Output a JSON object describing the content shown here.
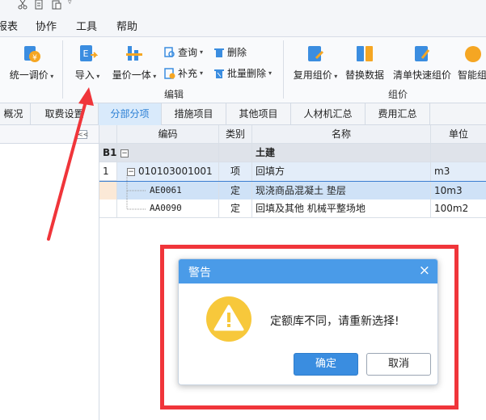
{
  "menu": {
    "items": [
      "报表",
      "协作",
      "工具",
      "帮助"
    ]
  },
  "ribbon": {
    "unified_price": "统一调价",
    "import": "导入",
    "price_integration": "量价一体",
    "query": "查询",
    "supplement": "补充",
    "delete": "删除",
    "batch_delete": "批量删除",
    "edit_group": "编辑",
    "reuse_pricing": "复用组价",
    "replace_data": "替换数据",
    "quick_list_pricing": "清单快速组价",
    "smart_pricing": "智能组",
    "pricing_group": "组价"
  },
  "tabs": [
    "概况",
    "取费设置",
    "分部分项",
    "措施项目",
    "其他项目",
    "人材机汇总",
    "费用汇总"
  ],
  "active_tab": "分部分项",
  "left_pane": {
    "collapse_label": "<<"
  },
  "grid": {
    "headers": {
      "code": "编码",
      "type": "类别",
      "name": "名称",
      "unit": "单位"
    },
    "rows": [
      {
        "index": "B1",
        "toggle": "−",
        "code": "",
        "type": "",
        "name": "土建",
        "unit": ""
      },
      {
        "index": "1",
        "toggle": "−",
        "code": "010103001001",
        "type": "项",
        "name": "回填方",
        "unit": "m3"
      },
      {
        "index": "",
        "toggle": "",
        "code": "AE0061",
        "type": "定",
        "name": "现浇商品混凝土 垫层",
        "unit": "10m3"
      },
      {
        "index": "",
        "toggle": "",
        "code": "AA0090",
        "type": "定",
        "name": "回填及其他 机械平整场地",
        "unit": "100m2"
      }
    ]
  },
  "dialog": {
    "title": "警告",
    "close": "×",
    "message": "定额库不同，请重新选择!",
    "ok": "确定",
    "cancel": "取消"
  },
  "colors": {
    "accent": "#3a8de0",
    "dialog_header": "#4a9be8",
    "highlight_red": "#f0353a",
    "warning_yellow": "#f7c83b"
  }
}
